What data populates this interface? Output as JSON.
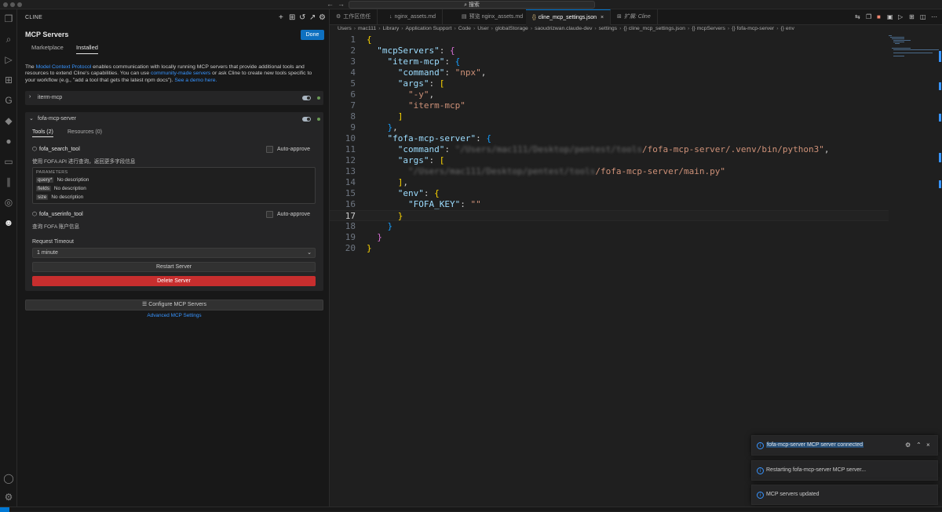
{
  "titlebar": {
    "search_label": "搜索",
    "back_arrow": "←",
    "forward_arrow": "→"
  },
  "sidebar": {
    "header": "CLINE",
    "panel_title": "MCP Servers",
    "done_label": "Done",
    "tabs": [
      "Marketplace",
      "Installed"
    ],
    "intro": {
      "part1": "The ",
      "link1": "Model Context Protocol",
      "part2": " enables communication with locally running MCP servers that provide additional tools and resources to extend Cline's capabilities. You can use ",
      "link2": "community-made servers",
      "part3": " or ask Cline to create new tools specific to your workflow (e.g., \"add a tool that gets the latest npm docs\"). ",
      "link3": "See a demo here."
    },
    "servers": [
      {
        "name": "iterm-mcp"
      },
      {
        "name": "fofa-mcp-server",
        "tools_tab": "Tools (2)",
        "resources_tab": "Resources (0)",
        "tools": [
          {
            "name": "fofa_search_tool",
            "auto_approve": "Auto-approve",
            "description": "使用 FOFA API 进行查询，返回更多字段信息",
            "params_title": "PARAMETERS",
            "params": [
              {
                "key": "query*",
                "desc": "No description"
              },
              {
                "key": "fields",
                "desc": "No description"
              },
              {
                "key": "size",
                "desc": "No description"
              }
            ]
          },
          {
            "name": "fofa_userinfo_tool",
            "auto_approve": "Auto-approve",
            "description": "查询 FOFA 账户信息"
          }
        ],
        "timeout_label": "Request Timeout",
        "timeout_value": "1 minute",
        "restart_label": "Restart Server",
        "delete_label": "Delete Server"
      }
    ],
    "configure_label": "Configure MCP Servers",
    "advanced_label": "Advanced MCP Settings"
  },
  "editor": {
    "tabs": [
      {
        "label": "工作区信任",
        "icon": ""
      },
      {
        "label": "nginx_assets.md",
        "icon": ""
      },
      {
        "label": "预览 nginx_assets.md",
        "icon": ""
      },
      {
        "label": "cline_mcp_settings.json",
        "icon": "{}",
        "active": true
      },
      {
        "label": "扩展: Cline",
        "icon": ""
      }
    ],
    "breadcrumb": [
      "Users",
      "mac111",
      "Library",
      "Application Support",
      "Code",
      "User",
      "globalStorage",
      "saoudrizwan.claude-dev",
      "settings",
      "{} cline_mcp_settings.json",
      "{} mcpServers",
      "{} fofa-mcp-server",
      "{} env"
    ],
    "current_line": 17,
    "code": {
      "l2_key": "\"mcpServers\"",
      "l3_key": "\"iterm-mcp\"",
      "l4_key": "\"command\"",
      "l4_val": "\"npx\"",
      "l5_key": "\"args\"",
      "l6_val": "\"-y\"",
      "l7_val": "\"iterm-mcp\"",
      "l10_key": "\"fofa-mcp-server\"",
      "l11_key": "\"command\"",
      "l11_blur": "\"/Users/mac111/Desktop/pentest/tools",
      "l11_val": "/fofa-mcp-server/.venv/bin/python3\"",
      "l12_key": "\"args\"",
      "l13_blur": "\"/Users/mac111/Desktop/pentest/tools",
      "l13_val": "/fofa-mcp-server/main.py\"",
      "l15_key": "\"env\"",
      "l16_key": "\"FOFA_KEY\"",
      "l16_val": "\"\""
    }
  },
  "notifications": [
    {
      "text": "fofa-mcp-server MCP server connected"
    },
    {
      "text": "Restarting fofa-mcp-server MCP server..."
    },
    {
      "text": "MCP servers updated"
    }
  ],
  "colors": {
    "accent": "#0e70c0",
    "danger": "#c72e2e",
    "link": "#3794ff",
    "connected": "#6a9955"
  }
}
